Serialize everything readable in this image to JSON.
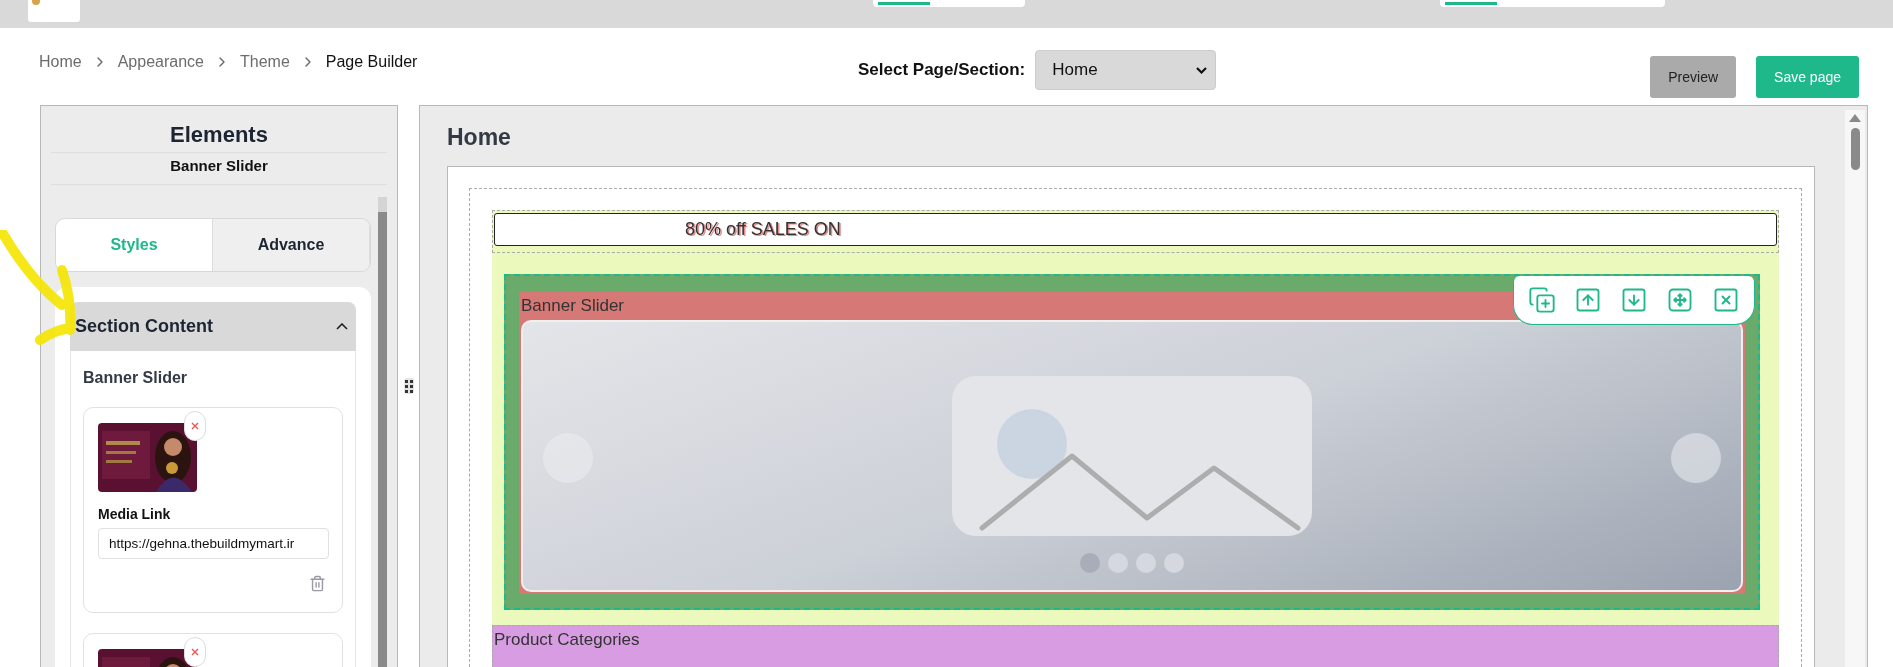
{
  "breadcrumb": [
    {
      "label": "Home",
      "current": false
    },
    {
      "label": "Appearance",
      "current": false
    },
    {
      "label": "Theme",
      "current": false
    },
    {
      "label": "Page Builder",
      "current": true
    }
  ],
  "page_select": {
    "label": "Select Page/Section:",
    "value": "Home"
  },
  "buttons": [
    {
      "label": "Preview",
      "kind": "secondary"
    },
    {
      "label": "Save page",
      "kind": "primary"
    }
  ],
  "elements_panel": {
    "title": "Elements",
    "subtitle": "Banner Slider",
    "tabs": [
      {
        "label": "Styles",
        "selected": true
      },
      {
        "label": "Advance",
        "selected": false
      }
    ],
    "section": {
      "title": "Section Content",
      "expanded": true,
      "heading": "Banner Slider",
      "items": [
        {
          "thumbnail": {
            "kind": "picture"
          },
          "media_label": "Media Link",
          "media_link": "https://gehna.thebuildmymart.ir"
        },
        {
          "thumbnail": {
            "kind": "picture"
          }
        }
      ]
    }
  },
  "canvas": {
    "title": "Home",
    "announcement": "80% off SALES ON",
    "sections": [
      {
        "kind": "slider",
        "label": "Banner Slider",
        "color": "#d67876",
        "selected": true,
        "dots": [
          {
            "selected": true
          },
          {
            "selected": false
          },
          {
            "selected": false
          },
          {
            "selected": false
          }
        ]
      },
      {
        "kind": "plain",
        "label": "Product Categories",
        "color": "#d89ce2",
        "selected": false
      }
    ]
  }
}
